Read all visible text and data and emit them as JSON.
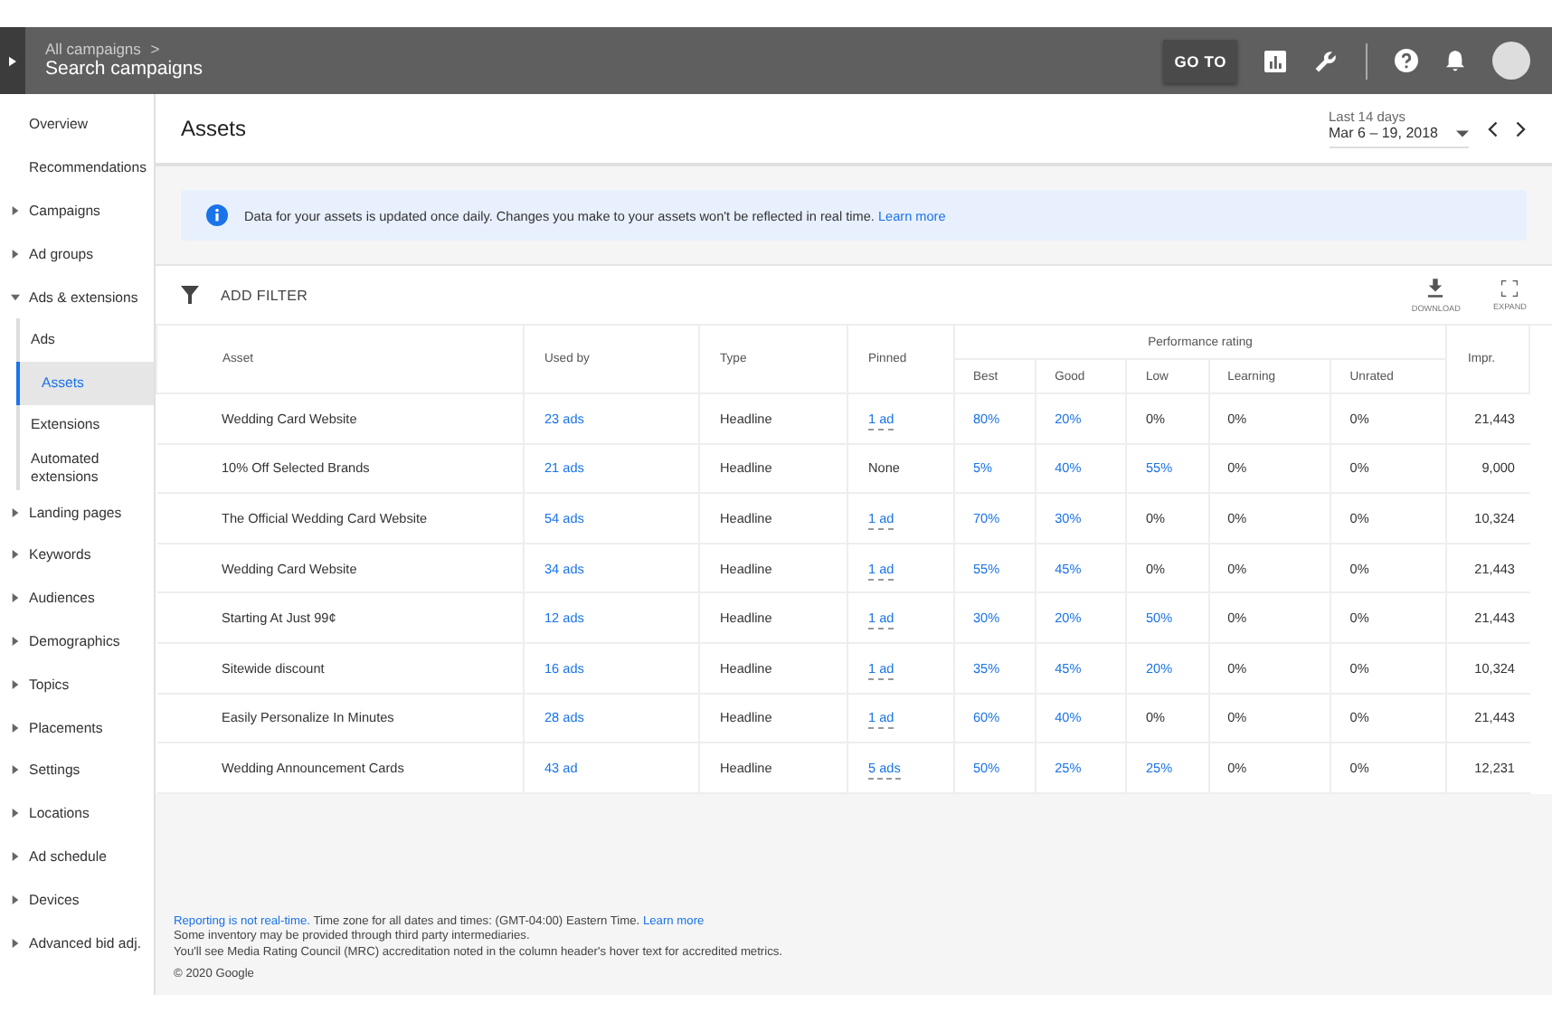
{
  "header": {
    "breadcrumb": "All campaigns",
    "breadcrumb_separator": ">",
    "title": "Search campaigns",
    "goto_button": "GO TO"
  },
  "sidebar": {
    "items": [
      {
        "label": "Overview",
        "kind": "plain",
        "selected": false
      },
      {
        "label": "Recommendations",
        "kind": "plain",
        "selected": false
      },
      {
        "label": "Campaigns",
        "kind": "group",
        "expanded": false,
        "selected": false
      },
      {
        "label": "Ad groups",
        "kind": "group",
        "expanded": false,
        "selected": false
      },
      {
        "label": "Ads & extensions",
        "kind": "group",
        "expanded": true,
        "selected": false,
        "children": [
          {
            "label": "Ads",
            "kind": "plain",
            "selected": false
          },
          {
            "label": "Assets",
            "kind": "plain",
            "selected": true
          },
          {
            "label": "Extensions",
            "kind": "plain",
            "selected": false
          },
          {
            "label": "Automated extensions",
            "kind": "plain",
            "selected": false
          }
        ]
      },
      {
        "label": "Landing pages",
        "kind": "group",
        "expanded": false,
        "selected": false
      },
      {
        "label": "Keywords",
        "kind": "group",
        "expanded": false,
        "selected": false
      },
      {
        "label": "Audiences",
        "kind": "group",
        "expanded": false,
        "selected": false
      },
      {
        "label": "Demographics",
        "kind": "group",
        "expanded": false,
        "selected": false
      },
      {
        "label": "Topics",
        "kind": "group",
        "expanded": false,
        "selected": false
      },
      {
        "label": "Placements",
        "kind": "group",
        "expanded": false,
        "selected": false
      },
      {
        "label": "Settings",
        "kind": "group",
        "expanded": false,
        "selected": false
      },
      {
        "label": "Locations",
        "kind": "group",
        "expanded": false,
        "selected": false
      },
      {
        "label": "Ad schedule",
        "kind": "group",
        "expanded": false,
        "selected": false
      },
      {
        "label": "Devices",
        "kind": "group",
        "expanded": false,
        "selected": false
      },
      {
        "label": "Advanced bid adj.",
        "kind": "group",
        "expanded": false,
        "selected": false
      }
    ]
  },
  "page": {
    "title": "Assets",
    "date_label": "Last 14 days",
    "date_range": "Mar 6 – 19, 2018"
  },
  "banner": {
    "text": "Data for your assets is updated once daily. Changes you make to your assets won't be reflected in real time.",
    "link": "Learn more"
  },
  "toolbar": {
    "filter": "ADD FILTER",
    "download": "DOWNLOAD",
    "expand": "EXPAND"
  },
  "table": {
    "columns": [
      "Asset",
      "Used by",
      "Type",
      "Pinned"
    ],
    "group_header": "Performance rating",
    "sub_columns": [
      "Best",
      "Good",
      "Low",
      "Learning",
      "Unrated"
    ],
    "last_column": "Impr.",
    "rows": [
      {
        "asset": "Wedding Card Website",
        "used_by": "23 ads",
        "type": "Headline",
        "pinned": {
          "text": "1 ad",
          "link": true
        },
        "ratings": [
          {
            "text": "80%",
            "link": true
          },
          {
            "text": "20%",
            "link": true
          },
          {
            "text": "0%",
            "link": false
          },
          {
            "text": "0%",
            "link": false
          },
          {
            "text": "0%",
            "link": false
          }
        ],
        "impr": "21,443"
      },
      {
        "asset": "10% Off Selected Brands",
        "used_by": "21 ads",
        "type": "Headline",
        "pinned": {
          "text": "None",
          "link": false
        },
        "ratings": [
          {
            "text": "5%",
            "link": true
          },
          {
            "text": "40%",
            "link": true
          },
          {
            "text": "55%",
            "link": true
          },
          {
            "text": "0%",
            "link": false
          },
          {
            "text": "0%",
            "link": false
          }
        ],
        "impr": "9,000"
      },
      {
        "asset": "The Official Wedding Card Website",
        "used_by": "54 ads",
        "type": "Headline",
        "pinned": {
          "text": "1 ad",
          "link": true
        },
        "ratings": [
          {
            "text": "70%",
            "link": true
          },
          {
            "text": "30%",
            "link": true
          },
          {
            "text": "0%",
            "link": false
          },
          {
            "text": "0%",
            "link": false
          },
          {
            "text": "0%",
            "link": false
          }
        ],
        "impr": "10,324"
      },
      {
        "asset": "Wedding Card Website",
        "used_by": "34 ads",
        "type": "Headline",
        "pinned": {
          "text": "1 ad",
          "link": true
        },
        "ratings": [
          {
            "text": "55%",
            "link": true
          },
          {
            "text": "45%",
            "link": true
          },
          {
            "text": "0%",
            "link": false
          },
          {
            "text": "0%",
            "link": false
          },
          {
            "text": "0%",
            "link": false
          }
        ],
        "impr": "21,443"
      },
      {
        "asset": "Starting At Just 99¢",
        "used_by": "12 ads",
        "type": "Headline",
        "pinned": {
          "text": "1 ad",
          "link": true
        },
        "ratings": [
          {
            "text": "30%",
            "link": true
          },
          {
            "text": "20%",
            "link": true
          },
          {
            "text": "50%",
            "link": true
          },
          {
            "text": "0%",
            "link": false
          },
          {
            "text": "0%",
            "link": false
          }
        ],
        "impr": "21,443"
      },
      {
        "asset": "Sitewide discount",
        "used_by": "16 ads",
        "type": "Headline",
        "pinned": {
          "text": "1 ad",
          "link": true
        },
        "ratings": [
          {
            "text": "35%",
            "link": true
          },
          {
            "text": "45%",
            "link": true
          },
          {
            "text": "20%",
            "link": true
          },
          {
            "text": "0%",
            "link": false
          },
          {
            "text": "0%",
            "link": false
          }
        ],
        "impr": "10,324"
      },
      {
        "asset": "Easily Personalize In Minutes",
        "used_by": "28 ads",
        "type": "Headline",
        "pinned": {
          "text": "1 ad",
          "link": true
        },
        "ratings": [
          {
            "text": "60%",
            "link": true
          },
          {
            "text": "40%",
            "link": true
          },
          {
            "text": "0%",
            "link": false
          },
          {
            "text": "0%",
            "link": false
          },
          {
            "text": "0%",
            "link": false
          }
        ],
        "impr": "21,443"
      },
      {
        "asset": "Wedding Announcement Cards",
        "used_by": "43 ad",
        "type": "Headline",
        "pinned": {
          "text": "5 ads",
          "link": true
        },
        "ratings": [
          {
            "text": "50%",
            "link": true
          },
          {
            "text": "25%",
            "link": true
          },
          {
            "text": "25%",
            "link": true
          },
          {
            "text": "0%",
            "link": false
          },
          {
            "text": "0%",
            "link": false
          }
        ],
        "impr": "12,231"
      }
    ]
  },
  "footer": {
    "lines": [
      [
        {
          "text": "Reporting is not real-time.",
          "link": true
        },
        {
          "text": " Time zone for all dates and times: (GMT-04:00) Eastern Time. ",
          "link": false
        },
        {
          "text": "Learn more",
          "link": true
        }
      ],
      [
        {
          "text": "Some inventory may be provided through third party intermediaries.",
          "link": false
        }
      ],
      [
        {
          "text": "You'll see Media Rating Council (MRC) accreditation noted in the column header's hover text for accredited metrics.",
          "link": false
        }
      ]
    ],
    "copyright": "© 2020 Google"
  }
}
